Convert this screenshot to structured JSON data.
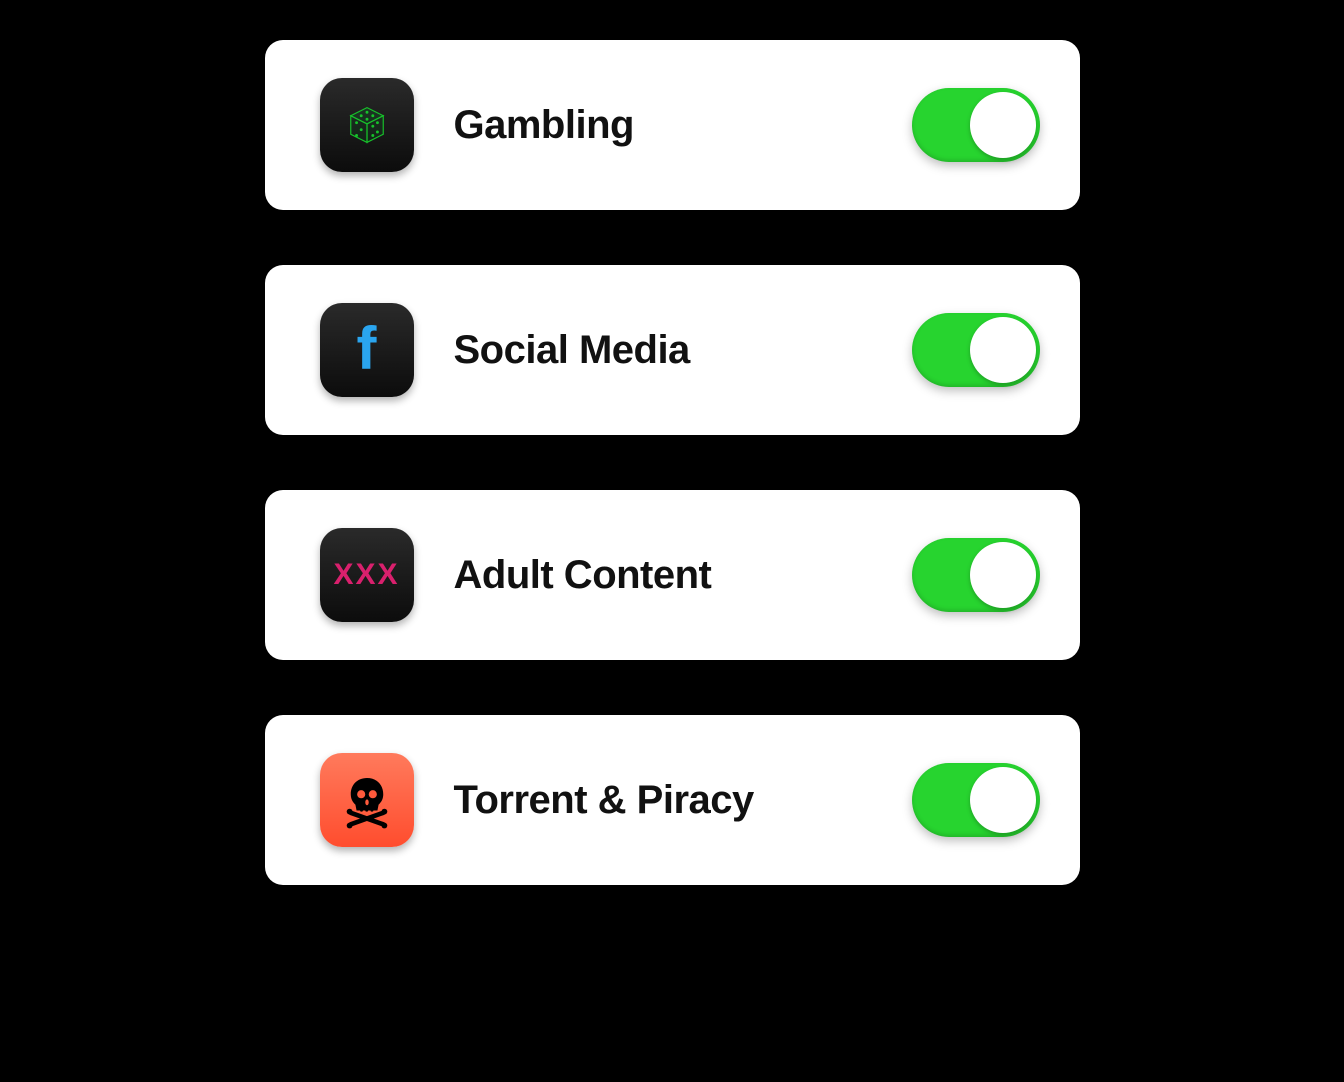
{
  "categories": [
    {
      "label": "Gambling",
      "icon": "dice-icon",
      "tile": "dark",
      "enabled": true
    },
    {
      "label": "Social Media",
      "icon": "facebook-icon",
      "tile": "dark",
      "enabled": true
    },
    {
      "label": "Adult Content",
      "icon": "xxx-icon",
      "tile": "dark",
      "enabled": true
    },
    {
      "label": "Torrent & Piracy",
      "icon": "skull-icon",
      "tile": "red",
      "enabled": true
    }
  ],
  "colors": {
    "toggle_on": "#27d42f",
    "tile_dark": "#161616",
    "tile_red": "#ff5238"
  }
}
